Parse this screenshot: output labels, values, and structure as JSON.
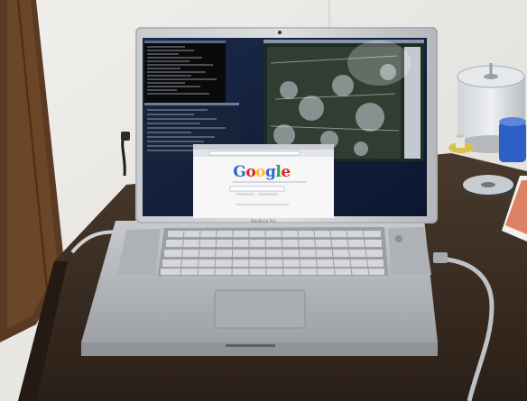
{
  "scene": {
    "subject": "laptop",
    "screen_windows": [
      "terminal",
      "image viewer",
      "web browser"
    ]
  },
  "laptop": {
    "brand_label": "MacBook Pro"
  },
  "browser": {
    "logo_text": "Google",
    "logo_colors": [
      "#3366cc",
      "#dd2222",
      "#ffbb22",
      "#3366cc",
      "#22aa44",
      "#dd2222"
    ]
  },
  "colors": {
    "wall": "#ecebe7",
    "desk": "#3c2e23",
    "door_wood": "#5a3a22",
    "aluminum": "#b9bcc0",
    "desktop_blue": "#0f1e3c"
  }
}
